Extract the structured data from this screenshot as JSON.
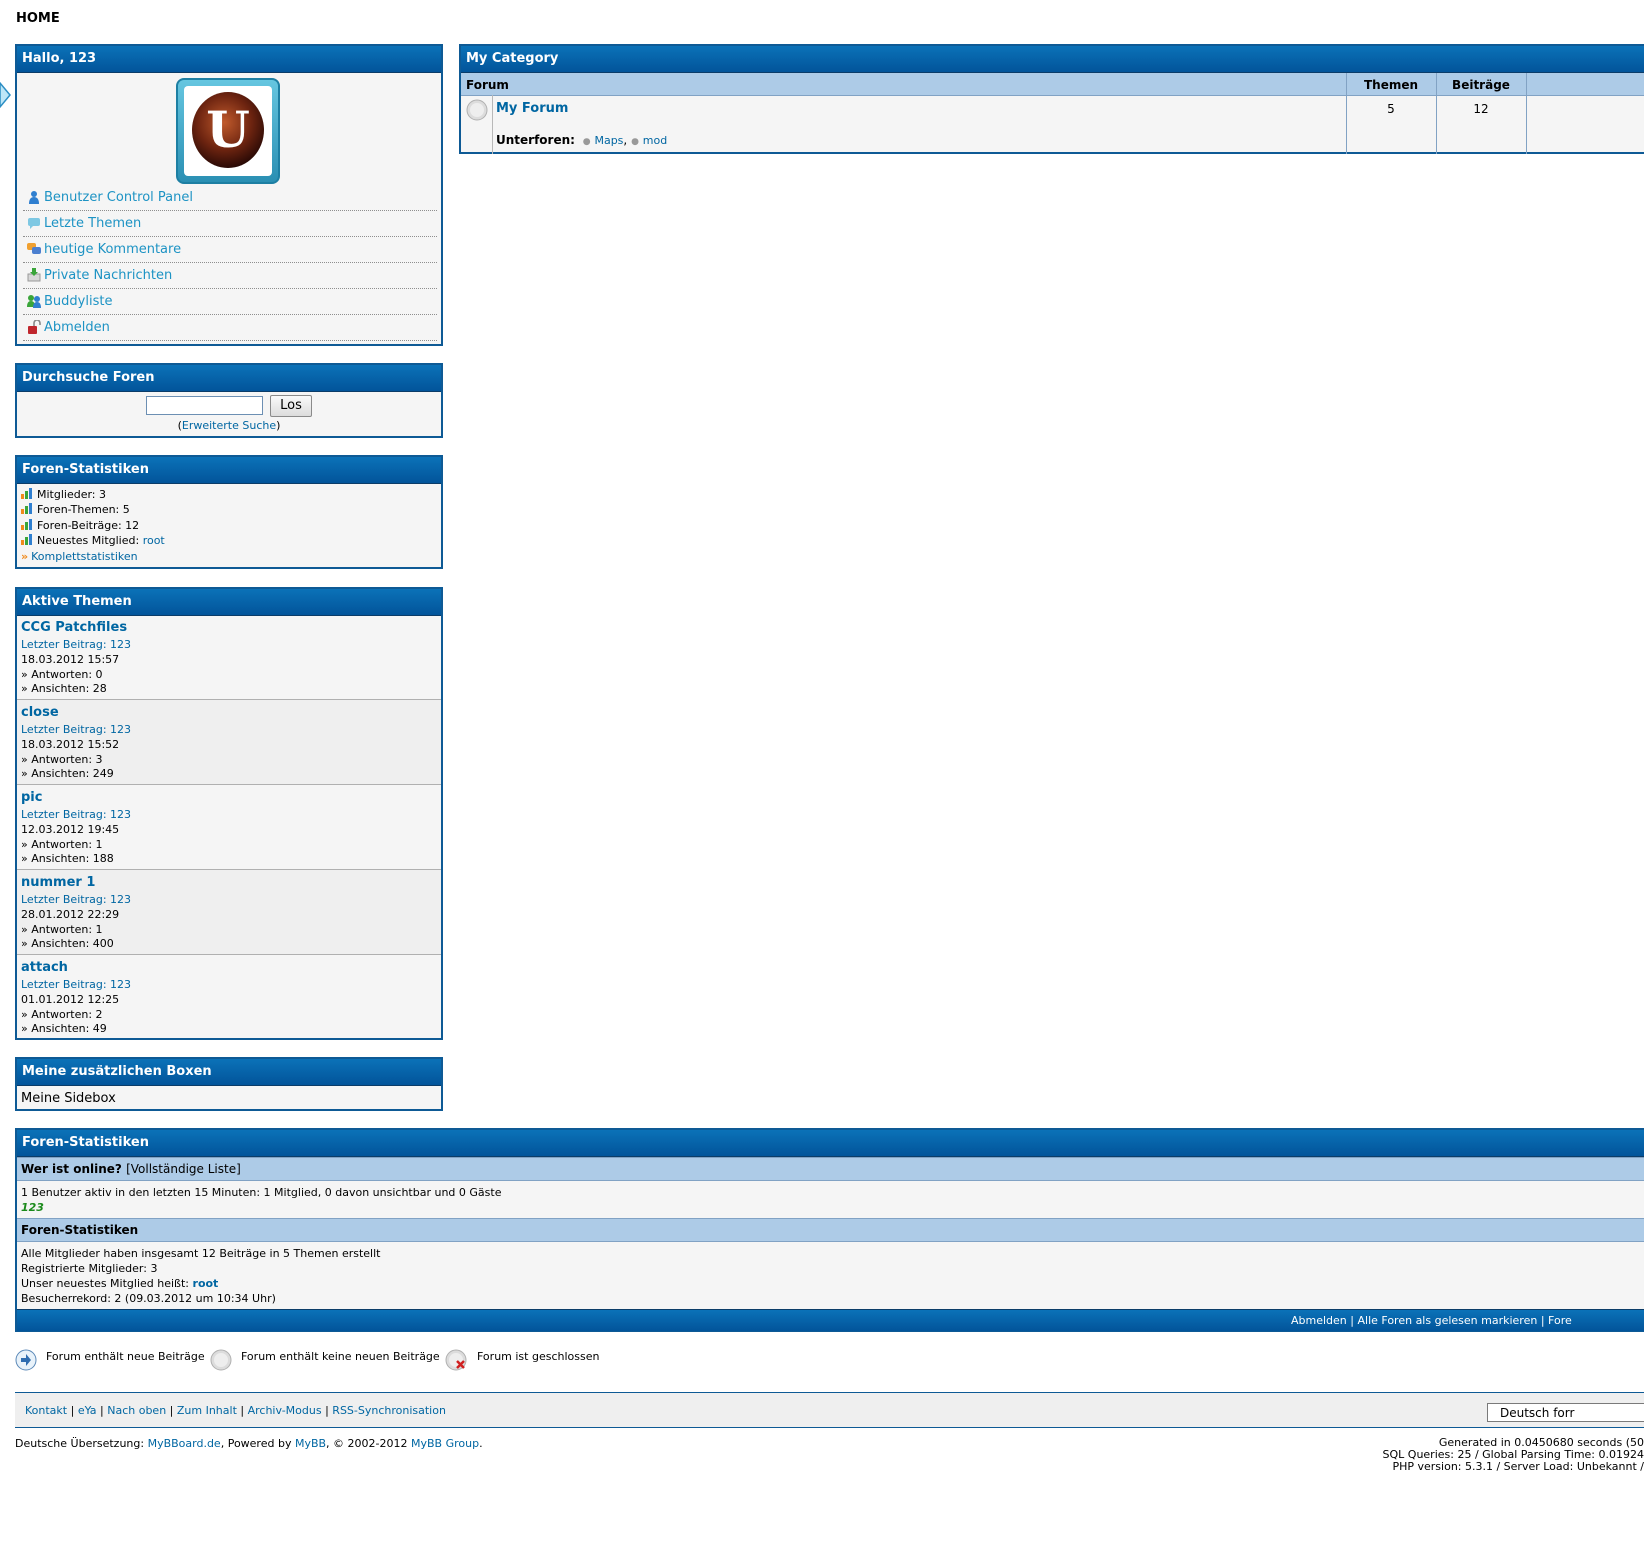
{
  "breadcrumb": "HOME",
  "welcome": {
    "title": "Hallo, 123",
    "avatar_letter": "U",
    "menu": [
      {
        "label": "Benutzer Control Panel",
        "icon": "user-icon"
      },
      {
        "label": "Letzte Themen",
        "icon": "speech-bubble-icon"
      },
      {
        "label": "heutige Kommentare",
        "icon": "comments-icon"
      },
      {
        "label": "Private Nachrichten",
        "icon": "inbox-icon"
      },
      {
        "label": "Buddyliste",
        "icon": "buddies-icon"
      },
      {
        "label": "Abmelden",
        "icon": "padlock-icon"
      }
    ]
  },
  "search": {
    "title": "Durchsuche Foren",
    "button": "Los",
    "paren_open": "(",
    "advanced": "Erweiterte Suche",
    "paren_close": ")"
  },
  "side_stats": {
    "title": "Foren-Statistiken",
    "rows": [
      "Mitglieder: 3",
      "Foren-Themen: 5",
      "Foren-Beiträge: 12"
    ],
    "newest_label": "Neuestes Mitglied:",
    "newest_user": "root",
    "full_stats": "Komplettstatistiken"
  },
  "active_threads": {
    "title": "Aktive Themen",
    "items": [
      {
        "title": "CCG Patchfiles",
        "last": "Letzter Beitrag: 123",
        "date": "18.03.2012 15:57",
        "replies": "» Antworten: 0",
        "views": "» Ansichten: 28"
      },
      {
        "title": "close",
        "last": "Letzter Beitrag: 123",
        "date": "18.03.2012 15:52",
        "replies": "» Antworten: 3",
        "views": "» Ansichten: 249"
      },
      {
        "title": "pic",
        "last": "Letzter Beitrag: 123",
        "date": "12.03.2012 19:45",
        "replies": "» Antworten: 1",
        "views": "» Ansichten: 188"
      },
      {
        "title": "nummer 1",
        "last": "Letzter Beitrag: 123",
        "date": "28.01.2012 22:29",
        "replies": "» Antworten: 1",
        "views": "» Ansichten: 400"
      },
      {
        "title": "attach",
        "last": "Letzter Beitrag: 123",
        "date": "01.01.2012 12:25",
        "replies": "» Antworten: 2",
        "views": "» Ansichten: 49"
      }
    ]
  },
  "custom_box": {
    "title": "Meine zusätzlichen Boxen",
    "content": "Meine Sidebox"
  },
  "category": {
    "title": "My Category",
    "headers": {
      "forum": "Forum",
      "threads": "Themen",
      "posts": "Beiträge"
    },
    "forum": {
      "name": "My Forum",
      "threads": "5",
      "posts": "12",
      "subforums_label": "Unterforen:",
      "subforums": [
        "Maps",
        "mod"
      ]
    }
  },
  "board_stats": {
    "title": "Foren-Statistiken",
    "online_title": "Wer ist online?",
    "online_full": "[Vollständige Liste]",
    "online_text": "1 Benutzer aktiv in den letzten 15 Minuten: 1 Mitglied, 0 davon unsichtbar und 0 Gäste",
    "online_user": "123",
    "stats_title": "Foren-Statistiken",
    "stats_line1": "Alle Mitglieder haben insgesamt 12 Beiträge in 5 Themen erstellt",
    "stats_line2": "Registrierte Mitglieder: 3",
    "stats_line3_label": "Unser neuestes Mitglied heißt:",
    "stats_line3_user": "root",
    "stats_line4": "Besucherrekord: 2 (09.03.2012 um 10:34 Uhr)",
    "bottom_links": [
      "Abmelden",
      "Alle Foren als gelesen markieren",
      "Fore"
    ]
  },
  "legend": [
    {
      "label": "Forum enthält neue Beiträge",
      "icon": "new-posts-icon"
    },
    {
      "label": "Forum enthält keine neuen Beiträge",
      "icon": "no-new-posts-icon"
    },
    {
      "label": "Forum ist geschlossen",
      "icon": "closed-forum-icon"
    }
  ],
  "footer": {
    "links": [
      "Kontakt",
      "eYa",
      "Nach oben",
      "Zum Inhalt",
      "Archiv-Modus",
      "RSS-Synchronisation"
    ],
    "lang_select": "Deutsch forr"
  },
  "credits": {
    "prefix": "Deutsche Übersetzung:",
    "mybboard": "MyBBoard.de",
    "powered": ", Powered by",
    "mybb": "MyBB",
    "copy": ", © 2002-2012",
    "group": "MyBB Group",
    "dot": "."
  },
  "debug": {
    "line1": "Generated in 0.0450680 seconds (50",
    "line2": "SQL Queries: 25 / Global Parsing Time: 0.01924",
    "line3": "PHP version: 5.3.1 / Server Load: Unbekannt /"
  },
  "colors": {
    "header_blue": "#02549a",
    "category_blue": "#adcbe7",
    "link": "#0066a2",
    "menu_link": "#1d93c4",
    "online_user": "#1b8a1b"
  }
}
